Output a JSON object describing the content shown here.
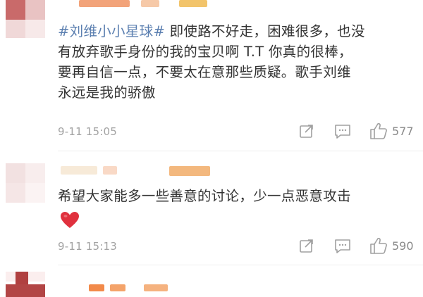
{
  "comments": [
    {
      "topic": "#刘维小小星球#",
      "lines": [
        " 即使路不好走，困难很多，也没",
        "有放弃歌手身份的我的宝贝啊 T.T 你真的很棒，",
        "要再自信一点，不要太在意那些质疑。歌手刘维",
        "永远是我的骄傲"
      ],
      "timestamp": "9-11 15:05",
      "likes": "577"
    },
    {
      "lines": [
        "希望大家能多一些善意的讨论，少一点恶意攻击"
      ],
      "emoji": "heart",
      "timestamp": "9-11 15:13",
      "likes": "590"
    }
  ],
  "icons": {
    "share": "share-icon",
    "comment": "comment-icon",
    "like": "thumbs-up-icon",
    "heart": "heart-emoji-icon"
  },
  "colors": {
    "topic": "#5b7fb0",
    "text": "#333333",
    "meta": "#a3a3a3",
    "heart": "#e0313e",
    "avatar_red": "#b04040"
  }
}
